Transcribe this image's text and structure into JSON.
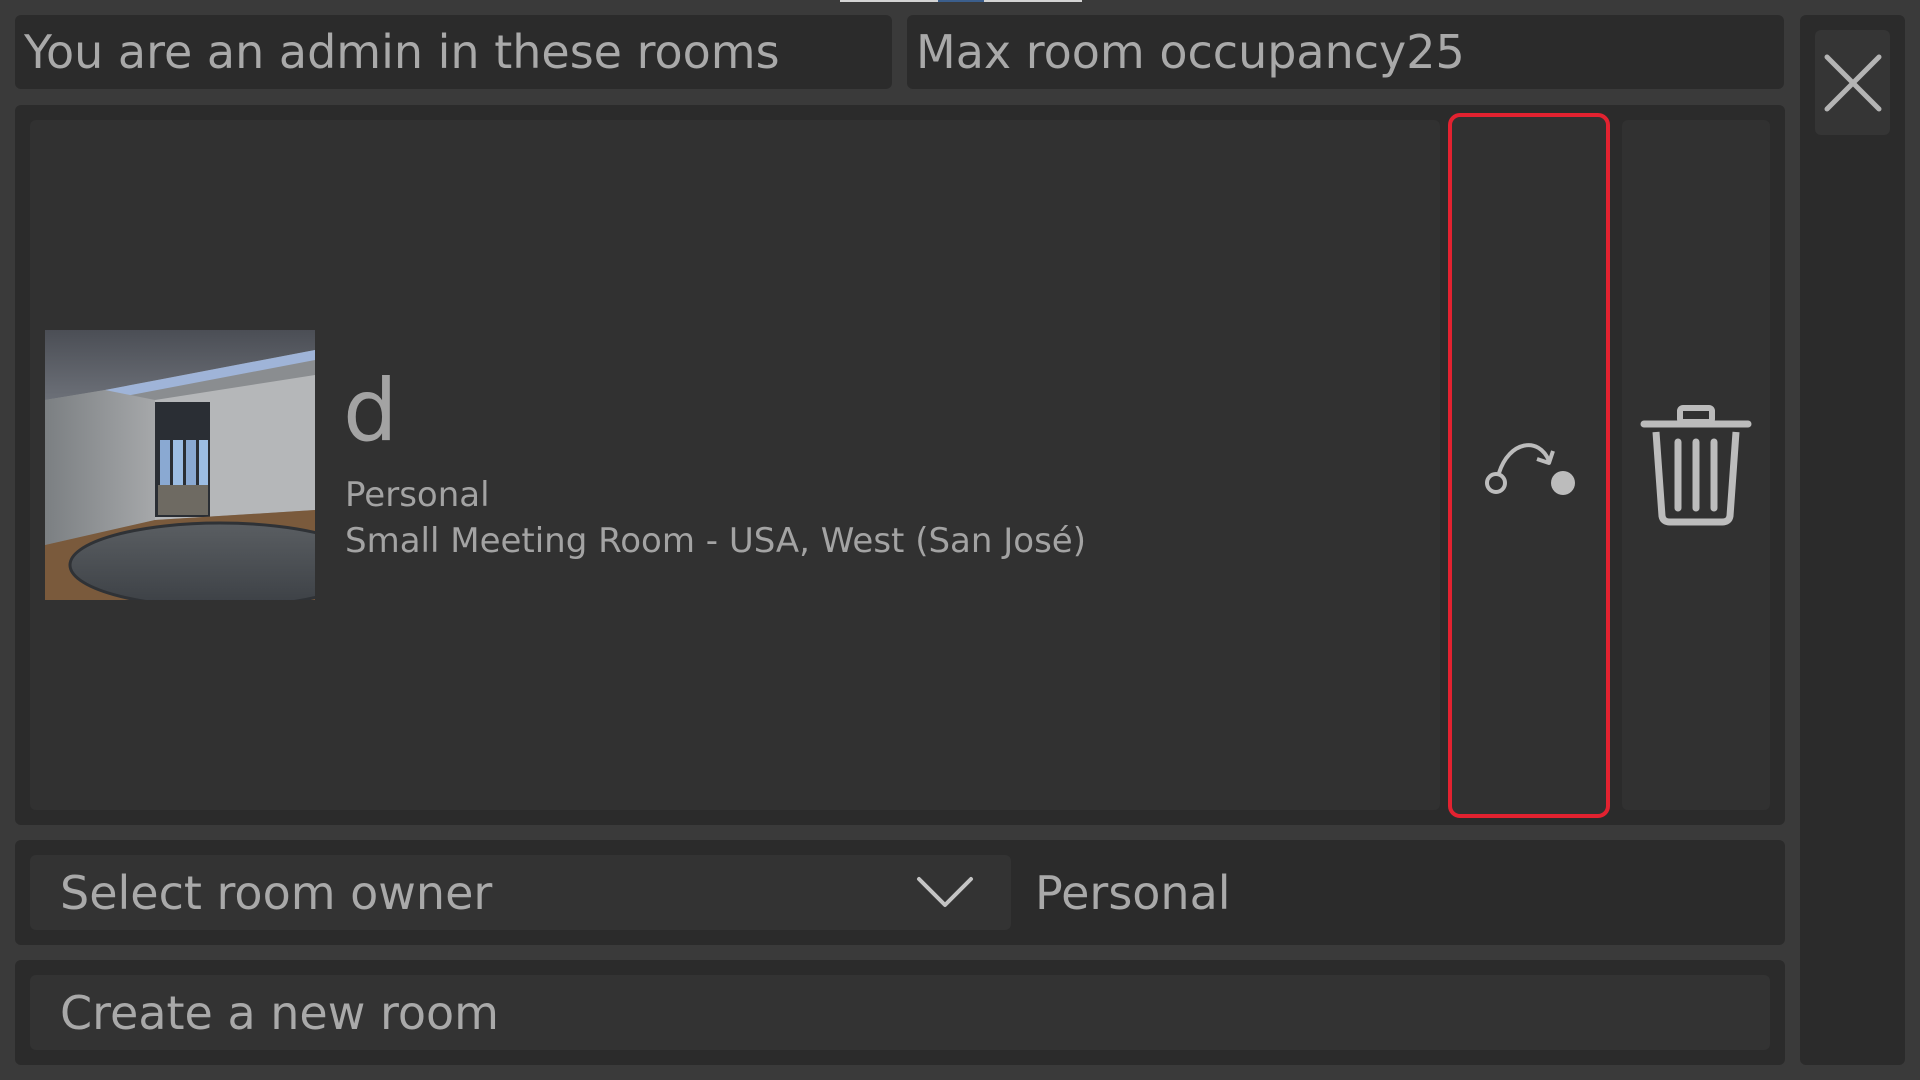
{
  "header": {
    "admin_label": "You are an admin in these rooms",
    "occupancy_label": "Max room occupancy25"
  },
  "room": {
    "name": "d",
    "type": "Personal",
    "description": "Small Meeting Room - USA, West (San José)"
  },
  "owner": {
    "placeholder": "Select room owner",
    "value": "Personal"
  },
  "create": {
    "label": "Create a new room"
  },
  "icons": {
    "close": "close-icon",
    "join": "join-room-icon",
    "delete": "trash-icon",
    "dropdown": "chevron-down-icon"
  },
  "colors": {
    "highlight_border": "#e22230",
    "panel_bg": "#2b2b2b",
    "text": "#a9a9a9"
  }
}
